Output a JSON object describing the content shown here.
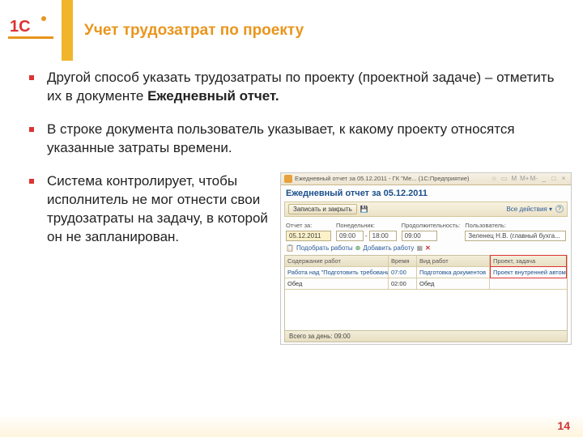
{
  "slide": {
    "title": "Учет трудозатрат по проекту",
    "page_number": "14",
    "bullets": [
      "Другой способ указать трудозатраты по проекту (проектной задаче) – отметить их в документе ",
      "В строке документа пользователь указывает, к какому проекту относятся указанные затраты времени.",
      "Система контролирует, чтобы исполнитель не мог отнести свои трудозатраты на задачу, в которой он не запланирован."
    ],
    "bullet0_bold": "Ежедневный отчет."
  },
  "shot": {
    "window_title": "Ежедневный отчет за 05.12.2011 - ГК \"Ме... (1С:Предприятие)",
    "doc_title": "Ежедневный отчет за 05.12.2011",
    "btn_save": "Записать и закрыть",
    "all_actions": "Все действия ▾",
    "labels": {
      "date": "Отчет за:",
      "mon": "Понедельник:",
      "dur": "Продолжительность:",
      "user": "Пользователь:"
    },
    "vals": {
      "date": "05.12.2011",
      "from": "09:00",
      "to": "18:00",
      "dur": "09:00",
      "user": "Зеленец Н.В. (главный бухга..."
    },
    "tb2": {
      "pick": "Подобрать работы",
      "add": "Добавить работу"
    },
    "cols": {
      "c1": "Содержание работ",
      "c2": "Время",
      "c3": "Вид работ",
      "c4": "Проект, задача"
    },
    "rows": [
      {
        "c1": "Работа над \"Подготовить требование к",
        "c2": "07:00",
        "c3": "Подготовка документов",
        "c4": "Проект внутренней автомати..."
      },
      {
        "c1": "Обед",
        "c2": "02:00",
        "c3": "Обед",
        "c4": ""
      }
    ],
    "total": "Всего за день: 09:00"
  }
}
